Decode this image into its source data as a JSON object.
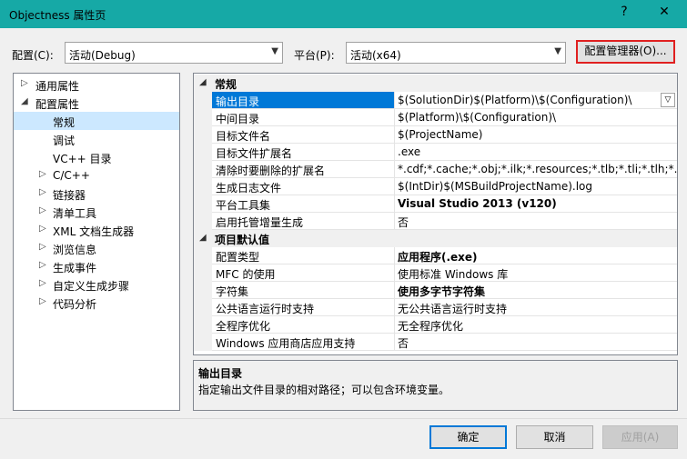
{
  "window": {
    "title": "Objectness 属性页",
    "help": "?",
    "close": "✕"
  },
  "toolbar": {
    "config_label": "配置(C):",
    "config_value": "活动(Debug)",
    "platform_label": "平台(P):",
    "platform_value": "活动(x64)",
    "config_manager_label": "配置管理器(O)..."
  },
  "tree": {
    "items": [
      {
        "label": "通用属性",
        "expander": "▷"
      },
      {
        "label": "配置属性",
        "expander": "◢"
      },
      {
        "label": "常规",
        "expander": ""
      },
      {
        "label": "调试",
        "expander": ""
      },
      {
        "label": "VC++ 目录",
        "expander": ""
      },
      {
        "label": "C/C++",
        "expander": "▷"
      },
      {
        "label": "链接器",
        "expander": "▷"
      },
      {
        "label": "清单工具",
        "expander": "▷"
      },
      {
        "label": "XML 文档生成器",
        "expander": "▷"
      },
      {
        "label": "浏览信息",
        "expander": "▷"
      },
      {
        "label": "生成事件",
        "expander": "▷"
      },
      {
        "label": "自定义生成步骤",
        "expander": "▷"
      },
      {
        "label": "代码分析",
        "expander": "▷"
      }
    ]
  },
  "grid": {
    "sections": [
      {
        "label": "常规",
        "expander": "◢"
      },
      {
        "label": "项目默认值",
        "expander": "◢"
      }
    ],
    "general_rows": [
      {
        "name": "输出目录",
        "value": "$(SolutionDir)$(Platform)\\$(Configuration)\\"
      },
      {
        "name": "中间目录",
        "value": "$(Platform)\\$(Configuration)\\"
      },
      {
        "name": "目标文件名",
        "value": "$(ProjectName)"
      },
      {
        "name": "目标文件扩展名",
        "value": ".exe"
      },
      {
        "name": "清除时要删除的扩展名",
        "value": "*.cdf;*.cache;*.obj;*.ilk;*.resources;*.tlb;*.tli;*.tlh;*.tmp;*"
      },
      {
        "name": "生成日志文件",
        "value": "$(IntDir)$(MSBuildProjectName).log"
      },
      {
        "name": "平台工具集",
        "value": "Visual Studio 2013 (v120)"
      },
      {
        "name": "启用托管增量生成",
        "value": "否"
      }
    ],
    "default_rows": [
      {
        "name": "配置类型",
        "value": "应用程序(.exe)"
      },
      {
        "name": "MFC 的使用",
        "value": "使用标准 Windows 库"
      },
      {
        "name": "字符集",
        "value": "使用多字节字符集"
      },
      {
        "name": "公共语言运行时支持",
        "value": "无公共语言运行时支持"
      },
      {
        "name": "全程序优化",
        "value": "无全程序优化"
      },
      {
        "name": "Windows 应用商店应用支持",
        "value": "否"
      }
    ],
    "dropdown_glyph": "▽"
  },
  "description": {
    "title": "输出目录",
    "text": "指定输出文件目录的相对路径；可以包含环境变量。"
  },
  "footer": {
    "ok": "确定",
    "cancel": "取消",
    "apply": "应用(A)"
  },
  "colors": {
    "titlebar": "#16a9a6",
    "selection": "#0078d7",
    "highlight_border": "#e02020"
  }
}
